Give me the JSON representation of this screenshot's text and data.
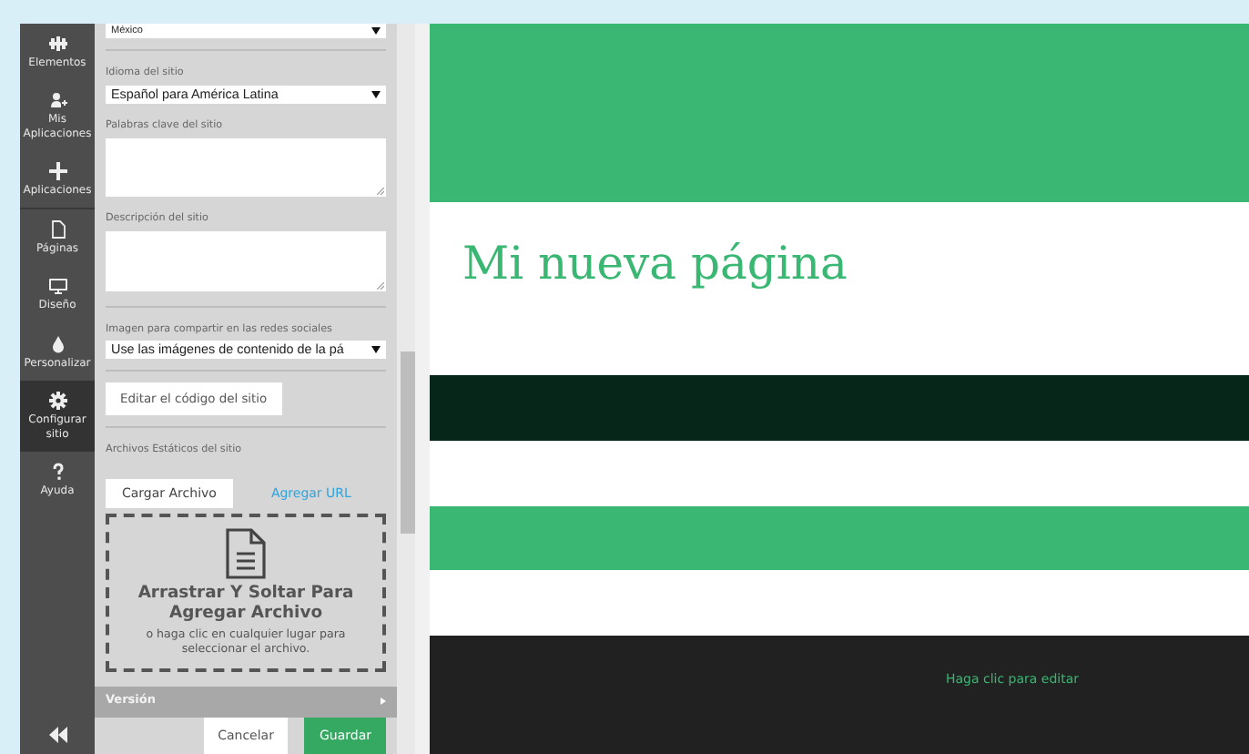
{
  "nav": [
    {
      "label": "Elementos",
      "selected": false
    },
    {
      "label": "Mis Aplicaciones",
      "selected": false
    },
    {
      "label": "Aplicaciones",
      "selected": false
    },
    {
      "label": "Páginas",
      "selected": false
    },
    {
      "label": "Diseño",
      "selected": false
    },
    {
      "label": "Personalizar",
      "selected": false
    },
    {
      "label": "Configurar sitio",
      "selected": true
    },
    {
      "label": "Ayuda",
      "selected": false
    }
  ],
  "panel": {
    "fields": [
      {
        "kind": "select",
        "value": "México"
      },
      {
        "kind": "select",
        "label": "Idioma del sitio",
        "value": "Español para América Latina"
      },
      {
        "kind": "textarea",
        "label": "Palabras clave del sitio"
      },
      {
        "kind": "textarea",
        "label": "Descripción del sitio"
      },
      {
        "kind": "select",
        "label": "Imagen para compartir en las redes sociales",
        "value": "Use las imágenes de contenido de la pá"
      },
      {
        "kind": "button",
        "value": "Editar el código del sitio"
      }
    ],
    "static_files": {
      "label": "Archivos Estáticos del sitio",
      "tabs": [
        {
          "label": "Cargar Archivo",
          "selected": true
        },
        {
          "label": "Agregar URL",
          "selected": false
        }
      ],
      "dropzone": {
        "title": "Arrastrar Y Soltar Para Agregar Archivo",
        "hint": "o haga clic en cualquier lugar para seleccionar el archivo."
      }
    },
    "version": {
      "label": "Versión",
      "expanded": false
    },
    "buttons": [
      {
        "label": "Cancelar",
        "kind": "secondary"
      },
      {
        "label": "Guardar",
        "kind": "primary"
      }
    ]
  },
  "preview": {
    "title": "Mi nueva página",
    "footer_link": "Haga clic para editar"
  }
}
